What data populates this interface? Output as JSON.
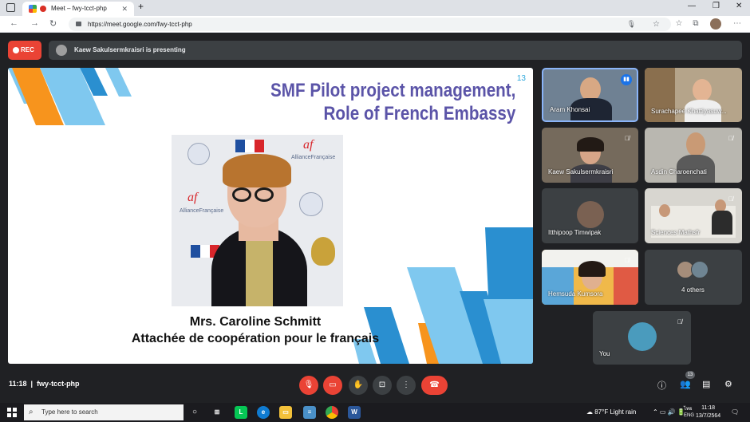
{
  "browser": {
    "tab_title": "Meet – fwy-tcct-php",
    "tab_close": "✕",
    "new_tab": "+",
    "url": "https://meet.google.com/fwy-tcct-php",
    "minimize": "—",
    "maximize": "❐",
    "close": "✕"
  },
  "meet": {
    "rec_label": "REC",
    "presenting_text": "Kaew Sakulsermkraisri is presenting",
    "time": "11:18",
    "meeting_code": "fwy-tcct-php",
    "participant_count": "13"
  },
  "slide": {
    "title_line1": "SMF Pilot project management,",
    "title_line2": "Role of French Embassy",
    "page_number": "13",
    "caption_name": "Mrs. Caroline Schmitt",
    "caption_role": "Attachée de coopération pour le français",
    "logo_af": "af",
    "logo_alliance": "AllianceFrançaise"
  },
  "participants": [
    {
      "name": "Aram Khonsai",
      "state": "speaking"
    },
    {
      "name": "Surachapee Khattiyasuw...",
      "state": "unmuted"
    },
    {
      "name": "Kaew Sakulsermkraisri",
      "state": "muted"
    },
    {
      "name": "Asdin Charoenchati",
      "state": "muted"
    },
    {
      "name": "Itthipoop Timwipak",
      "state": "unmuted"
    },
    {
      "name": "Sciences Mathsfr",
      "state": "muted"
    },
    {
      "name": "Hemsuda Kumsora",
      "state": "muted"
    },
    {
      "name": "4 others",
      "state": "group"
    },
    {
      "name": "You",
      "state": "muted"
    }
  ],
  "taskbar": {
    "search_placeholder": "Type here to search",
    "weather": "87°F  Light rain",
    "clock_time": "11:18",
    "clock_date": "13/7/2564",
    "language": "ENG"
  },
  "colors": {
    "rec_red": "#ea4335",
    "slide_title_purple": "#5b54a8",
    "stripe_orange": "#f7941d",
    "stripe_blue": "#2a8fd0",
    "stripe_lightblue": "#7fc8ef",
    "speaking_blue": "#1a73e8"
  }
}
